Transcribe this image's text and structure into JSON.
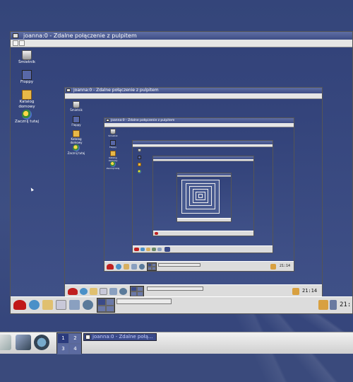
{
  "window_title": "joanna:0 - Zdalne połączenie z pulpitem",
  "desktop_icons": [
    {
      "label": "Śmietnik",
      "icon": "trash-icon"
    },
    {
      "label": "Floppy",
      "icon": "floppy-icon"
    },
    {
      "label": "Katalog domowy",
      "icon": "home-folder-icon"
    },
    {
      "label": "Zacznij tutaj",
      "icon": "start-here-icon"
    }
  ],
  "panel": {
    "clock_level1": "21:",
    "clock_level2": "21:14",
    "clock_level3": "21:14",
    "pager_workspaces": [
      "1",
      "2",
      "3",
      "4"
    ],
    "active_workspace": "1",
    "task_label": "joanna:0 - Zdalne połą..."
  },
  "colors": {
    "desktop": "#3a4a7c",
    "titlebar": "#4a5a94",
    "panel": "#dcdcdc",
    "task_active": "#3a4a8a"
  }
}
